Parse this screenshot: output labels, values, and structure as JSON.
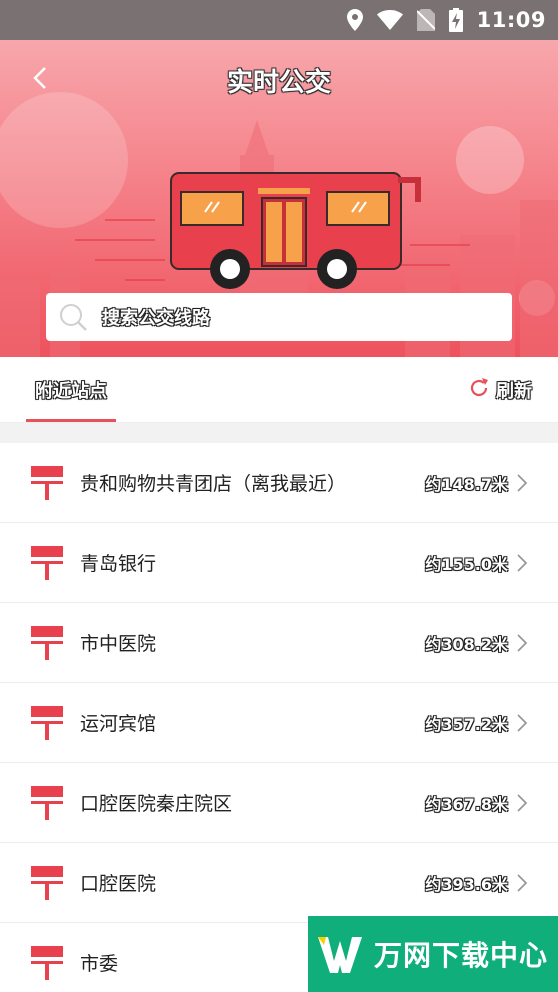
{
  "status_bar": {
    "time": "11:09",
    "icons": [
      "location-icon",
      "wifi-icon",
      "no-sim-icon",
      "battery-charging-icon"
    ]
  },
  "header": {
    "title": "实时公交",
    "back_icon": "chevron-left-icon",
    "search_placeholder": "搜索公交线路"
  },
  "tabs": {
    "nearby_label": "附近站点",
    "refresh_label": "刷新"
  },
  "stops": [
    {
      "name": "贵和购物共青团店（离我最近）",
      "distance": "约148.7米"
    },
    {
      "name": "青岛银行",
      "distance": "约155.0米"
    },
    {
      "name": "市中医院",
      "distance": "约308.2米"
    },
    {
      "name": "运河宾馆",
      "distance": "约357.2米"
    },
    {
      "name": "口腔医院秦庄院区",
      "distance": "约367.8米"
    },
    {
      "name": "口腔医院",
      "distance": "约393.6米"
    },
    {
      "name": "市委",
      "distance": ""
    }
  ],
  "watermark": {
    "text": "万网下载中心"
  },
  "colors": {
    "accent": "#e8505b",
    "header_top": "#f7a7ac",
    "header_bottom": "#ee525d",
    "watermark": "#0fae7a"
  }
}
